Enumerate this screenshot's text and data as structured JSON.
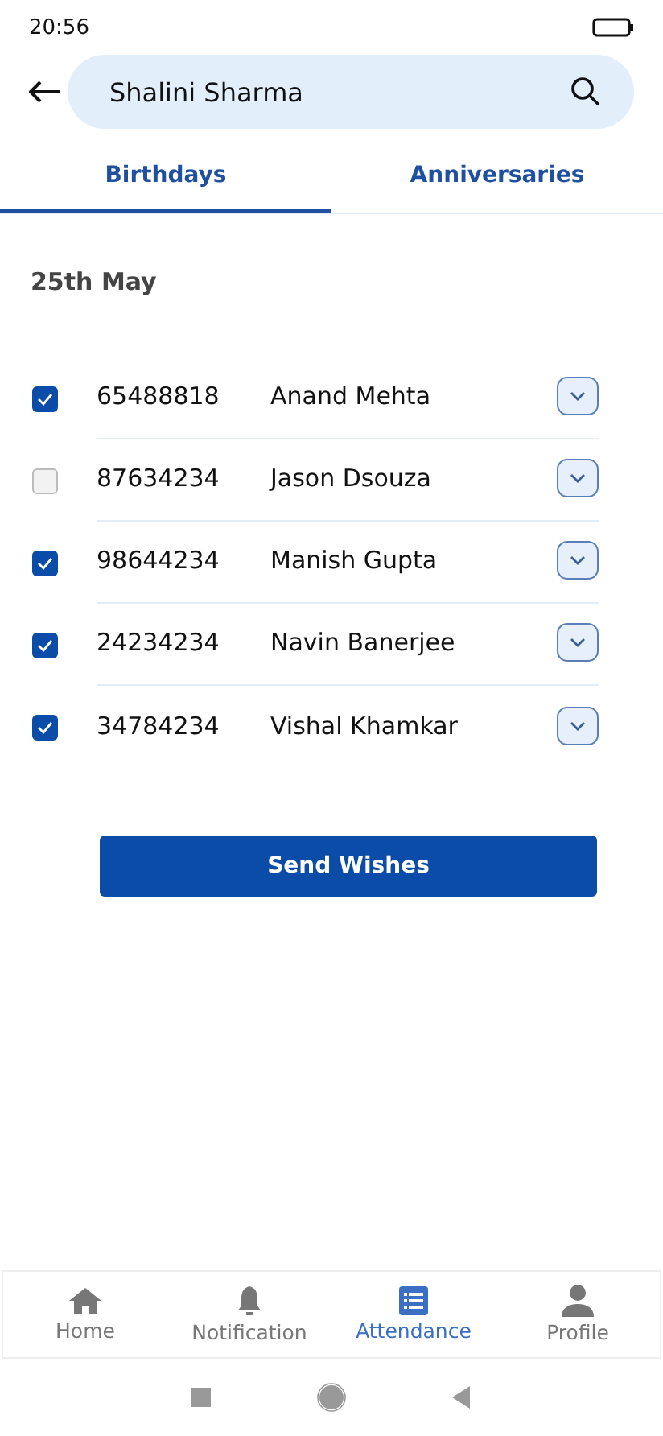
{
  "status_bar": {
    "time": "20:56"
  },
  "search": {
    "value": "Shalini Sharma"
  },
  "tabs": [
    {
      "label": "Birthdays",
      "selected": true
    },
    {
      "label": "Anniversaries",
      "selected": false
    }
  ],
  "date": "25th May",
  "people": [
    {
      "id": "65488818",
      "name": "Anand Mehta",
      "checked": true
    },
    {
      "id": "87634234",
      "name": "Jason Dsouza",
      "checked": false
    },
    {
      "id": "98644234",
      "name": "Manish Gupta",
      "checked": true
    },
    {
      "id": "24234234",
      "name": "Navin Banerjee",
      "checked": true
    },
    {
      "id": "34784234",
      "name": "Vishal Khamkar",
      "checked": true
    }
  ],
  "button": "Send Wishes",
  "nav": [
    {
      "kind": "home",
      "label": "Home",
      "selected": false
    },
    {
      "kind": "bell",
      "label": "Notification",
      "selected": false
    },
    {
      "kind": "list",
      "label": "Attendance",
      "selected": true
    },
    {
      "kind": "person",
      "label": "Profile",
      "selected": false
    }
  ]
}
